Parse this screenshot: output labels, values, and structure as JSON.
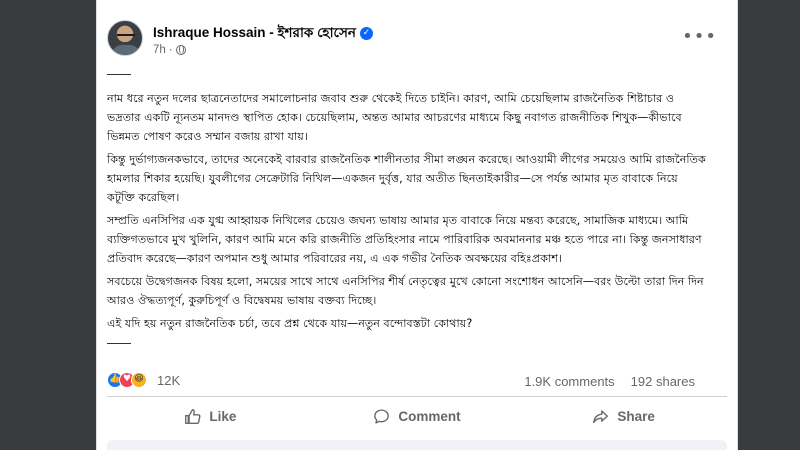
{
  "post": {
    "author": "Ishraque Hossain - ইশরাক হোসেন",
    "time": "7h",
    "time_separator": "·",
    "paragraphs": [
      "নাম ধরে নতুন দলের ছাত্রনেতাদের সমালোচনার জবাব শুরু থেকেই দিতে চাইনি। কারণ, আমি চেয়েছিলাম রাজনৈতিক শিষ্টাচার ও ভদ্রতার একটি ন্যূনতম মানদণ্ড স্থাপিত হোক। চেয়েছিলাম, অন্তত আমার আচরণের মাধ্যমে কিছু নবাগত রাজনীতিক শিখুক—কীভাবে ভিন্নমত পোষণ করেও সম্মান বজায় রাখা যায়।",
      "কিন্তু দুর্ভাগ্যজনকভাবে, তাদের অনেকেই বারবার রাজনৈতিক শালীনতার সীমা লঙ্ঘন করেছে। আওয়ামী লীগের সময়েও আমি রাজনৈতিক হামলার শিকার হয়েছি। যুবলীগের সেক্রেটারি নিখিল—একজন দুর্বৃত্ত, যার অতীত ছিনতাইকারীর—সে পর্যন্ত আমার মৃত বাবাকে নিয়ে কটূক্তি করেছিল।",
      "সম্প্রতি এনসিপির এক যুগ্ম আহ্বায়ক নিখিলের চেয়েও জঘন্য ভাষায় আমার মৃত বাবাকে নিয়ে মন্তব্য করেছে, সামাজিক মাধ্যমে। আমি ব্যক্তিগতভাবে মুখ খুলিনি, কারণ আমি মনে করি রাজনীতি প্রতিহিংসার নামে পারিবারিক অবমাননার মঞ্চ হতে পারে না। কিন্তু জনসাধারণ প্রতিবাদ করেছে—কারণ অপমান শুধু আমার পরিবারের নয়, এ এক গভীর নৈতিক অবক্ষয়ের বহিঃপ্রকাশ।",
      "সবচেয়ে উদ্বেগজনক বিষয় হলো, সময়ের সাথে সাথে এনসিপির শীর্ষ নেতৃত্বের মুখে কোনো সংশোধন আসেনি—বরং উল্টো তারা দিন দিন আরও ঔদ্ধত্যপূর্ণ, কুরুচিপূর্ণ ও বিদ্বেষময় ভাষায় বক্তব্য দিচ্ছে।",
      "এই যদি হয় নতুন রাজনৈতিক চর্চা, তবে প্রশ্ন থেকে যায়—নতুন বন্দোবস্তটা কোথায়?"
    ]
  },
  "engagement": {
    "reaction_count": "12K",
    "comments": "1.9K comments",
    "shares": "192 shares",
    "reaction_icons": [
      "like-icon",
      "love-icon",
      "haha-icon"
    ]
  },
  "actions": {
    "like": "Like",
    "comment": "Comment",
    "share": "Share"
  },
  "colors": {
    "accent": "#0866ff",
    "muted": "#65676b"
  }
}
